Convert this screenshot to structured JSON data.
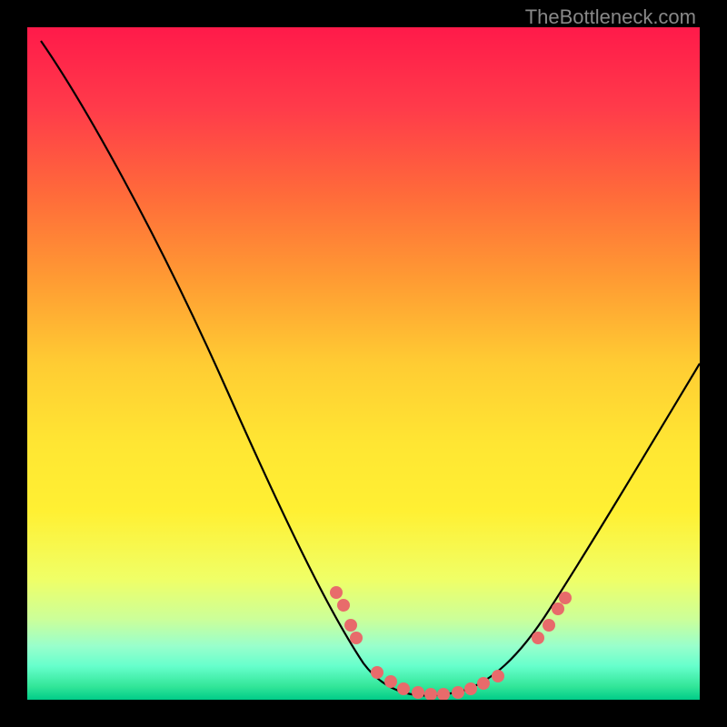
{
  "watermark": "TheBottleneck.com",
  "chart_data": {
    "type": "line",
    "title": "",
    "xlabel": "",
    "ylabel": "",
    "xlim": [
      0,
      100
    ],
    "ylim": [
      0,
      100
    ],
    "curve": {
      "name": "bottleneck-curve",
      "points": [
        {
          "x": 2,
          "y": 98
        },
        {
          "x": 10,
          "y": 90
        },
        {
          "x": 20,
          "y": 74
        },
        {
          "x": 30,
          "y": 52
        },
        {
          "x": 40,
          "y": 28
        },
        {
          "x": 47,
          "y": 11
        },
        {
          "x": 52,
          "y": 4
        },
        {
          "x": 58,
          "y": 1
        },
        {
          "x": 64,
          "y": 1
        },
        {
          "x": 70,
          "y": 3
        },
        {
          "x": 76,
          "y": 9
        },
        {
          "x": 84,
          "y": 22
        },
        {
          "x": 92,
          "y": 38
        },
        {
          "x": 100,
          "y": 53
        }
      ]
    },
    "markers": [
      {
        "x": 46,
        "y": 16
      },
      {
        "x": 47,
        "y": 14
      },
      {
        "x": 48,
        "y": 11
      },
      {
        "x": 49,
        "y": 9
      },
      {
        "x": 52,
        "y": 4
      },
      {
        "x": 54,
        "y": 2.5
      },
      {
        "x": 56,
        "y": 1.5
      },
      {
        "x": 58,
        "y": 1
      },
      {
        "x": 60,
        "y": 0.8
      },
      {
        "x": 62,
        "y": 0.8
      },
      {
        "x": 64,
        "y": 1
      },
      {
        "x": 66,
        "y": 1.5
      },
      {
        "x": 68,
        "y": 2.3
      },
      {
        "x": 70,
        "y": 3.2
      },
      {
        "x": 76,
        "y": 9
      },
      {
        "x": 77.5,
        "y": 11
      },
      {
        "x": 79,
        "y": 13.5
      },
      {
        "x": 80,
        "y": 15
      }
    ],
    "gradient_stops": [
      {
        "pos": 0,
        "color": "#ff1a4a"
      },
      {
        "pos": 50,
        "color": "#ffe033"
      },
      {
        "pos": 100,
        "color": "#00cc88"
      }
    ]
  }
}
